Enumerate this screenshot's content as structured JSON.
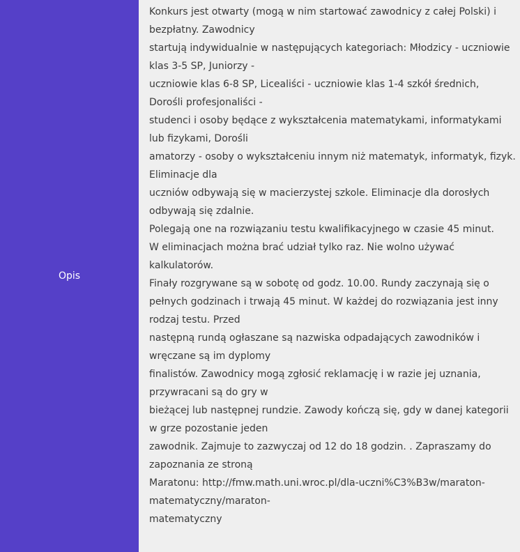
{
  "label": "Opis",
  "lines": [
    "Konkurs jest otwarty (mogą w nim startować zawodnicy z całej Polski) i bezpłatny. Zawodnicy",
    "startują indywidualnie w następujących kategoriach: Młodzicy - uczniowie klas 3-5 SP, Juniorzy -",
    "uczniowie klas 6-8 SP, Licealiści - uczniowie klas 1-4 szkół średnich, Dorośli profesjonaliści -",
    "studenci i osoby będące z wykształcenia matematykami, informatykami lub fizykami, Dorośli",
    "amatorzy - osoby o wykształceniu innym niż matematyk, informatyk, fizyk. Eliminacje dla",
    "uczniów odbywają się w macierzystej szkole. Eliminacje dla dorosłych odbywają się zdalnie.",
    "Polegają one na rozwiązaniu testu kwalifikacyjnego w czasie 45 minut.",
    "W eliminacjach można brać udział tylko raz. Nie wolno używać kalkulatorów.",
    "Finały rozgrywane są w sobotę od godz. 10.00. Rundy zaczynają się o",
    "pełnych godzinach i trwają 45 minut. W każdej do rozwiązania jest inny rodzaj testu. Przed",
    "następną rundą ogłaszane są nazwiska odpadających zawodników i wręczane są im dyplomy",
    "finalistów. Zawodnicy mogą zgłosić reklamację i w razie jej uznania, przywracani są do gry w",
    "bieżącej lub następnej rundzie. Zawody kończą się, gdy w danej kategorii w grze pozostanie jeden",
    "zawodnik. Zajmuje to zazwyczaj od 12 do 18 godzin. . Zapraszamy do zapoznania ze stroną",
    "Maratonu: http://fmw.math.uni.wroc.pl/dla-uczni%C3%B3w/maraton-matematyczny/maraton-",
    "matematyczny"
  ]
}
